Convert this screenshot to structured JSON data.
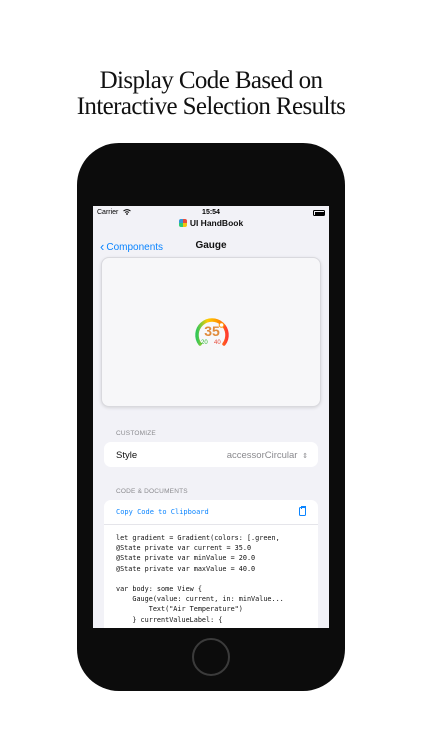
{
  "headline": {
    "line1": "Display Code Based on",
    "line2": "Interactive Selection Results"
  },
  "status_bar": {
    "carrier": "Carrier",
    "time": "15:54"
  },
  "app": {
    "title": "UI HandBook"
  },
  "nav": {
    "back_label": "Components",
    "title": "Gauge"
  },
  "gauge": {
    "value": "35",
    "min": "20",
    "max": "40",
    "level": 0.75,
    "colors": [
      "#34c759",
      "#ffcc00",
      "#ff9500",
      "#ff3b30"
    ]
  },
  "customize": {
    "header": "CUSTOMIZE",
    "style_label": "Style",
    "style_value": "accessorCircular"
  },
  "code_docs": {
    "header": "CODE & DOCUMENTS",
    "copy_label": "Copy Code to Clipboard",
    "lines": [
      "let gradient = Gradient(colors: [.green,",
      "@State private var current = 35.0",
      "@State private var minValue = 20.0",
      "@State private var maxValue = 40.0",
      "",
      "var body: some View {",
      "    Gauge(value: current, in: minValue...",
      "        Text(\"Air Temperature\")",
      "    } currentValueLabel: {"
    ]
  },
  "accent_color": "#0a84ff"
}
